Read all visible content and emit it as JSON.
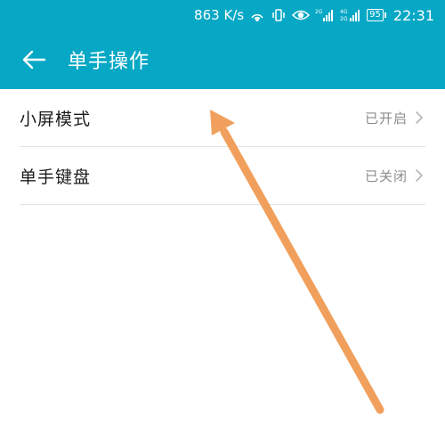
{
  "status_bar": {
    "speed": "863 K/s",
    "battery": "95",
    "time": "22:31",
    "icons": [
      "hotspot-icon",
      "vibrate-icon",
      "eye-comfort-icon",
      "signal-2g-icon",
      "signal-4g-icon",
      "battery-icon"
    ],
    "signal_labels": {
      "first": "2G",
      "second_top": "4G",
      "second_bottom": "2G"
    }
  },
  "app_bar": {
    "title": "单手操作",
    "back_icon": "arrow-left-icon",
    "background_color": "#07a8c5"
  },
  "settings": [
    {
      "label": "小屏模式",
      "value": "已开启"
    },
    {
      "label": "单手键盘",
      "value": "已关闭"
    }
  ],
  "annotation": {
    "arrow_color": "#f0a05c",
    "arrow_icon": "annotation-arrow-icon"
  }
}
